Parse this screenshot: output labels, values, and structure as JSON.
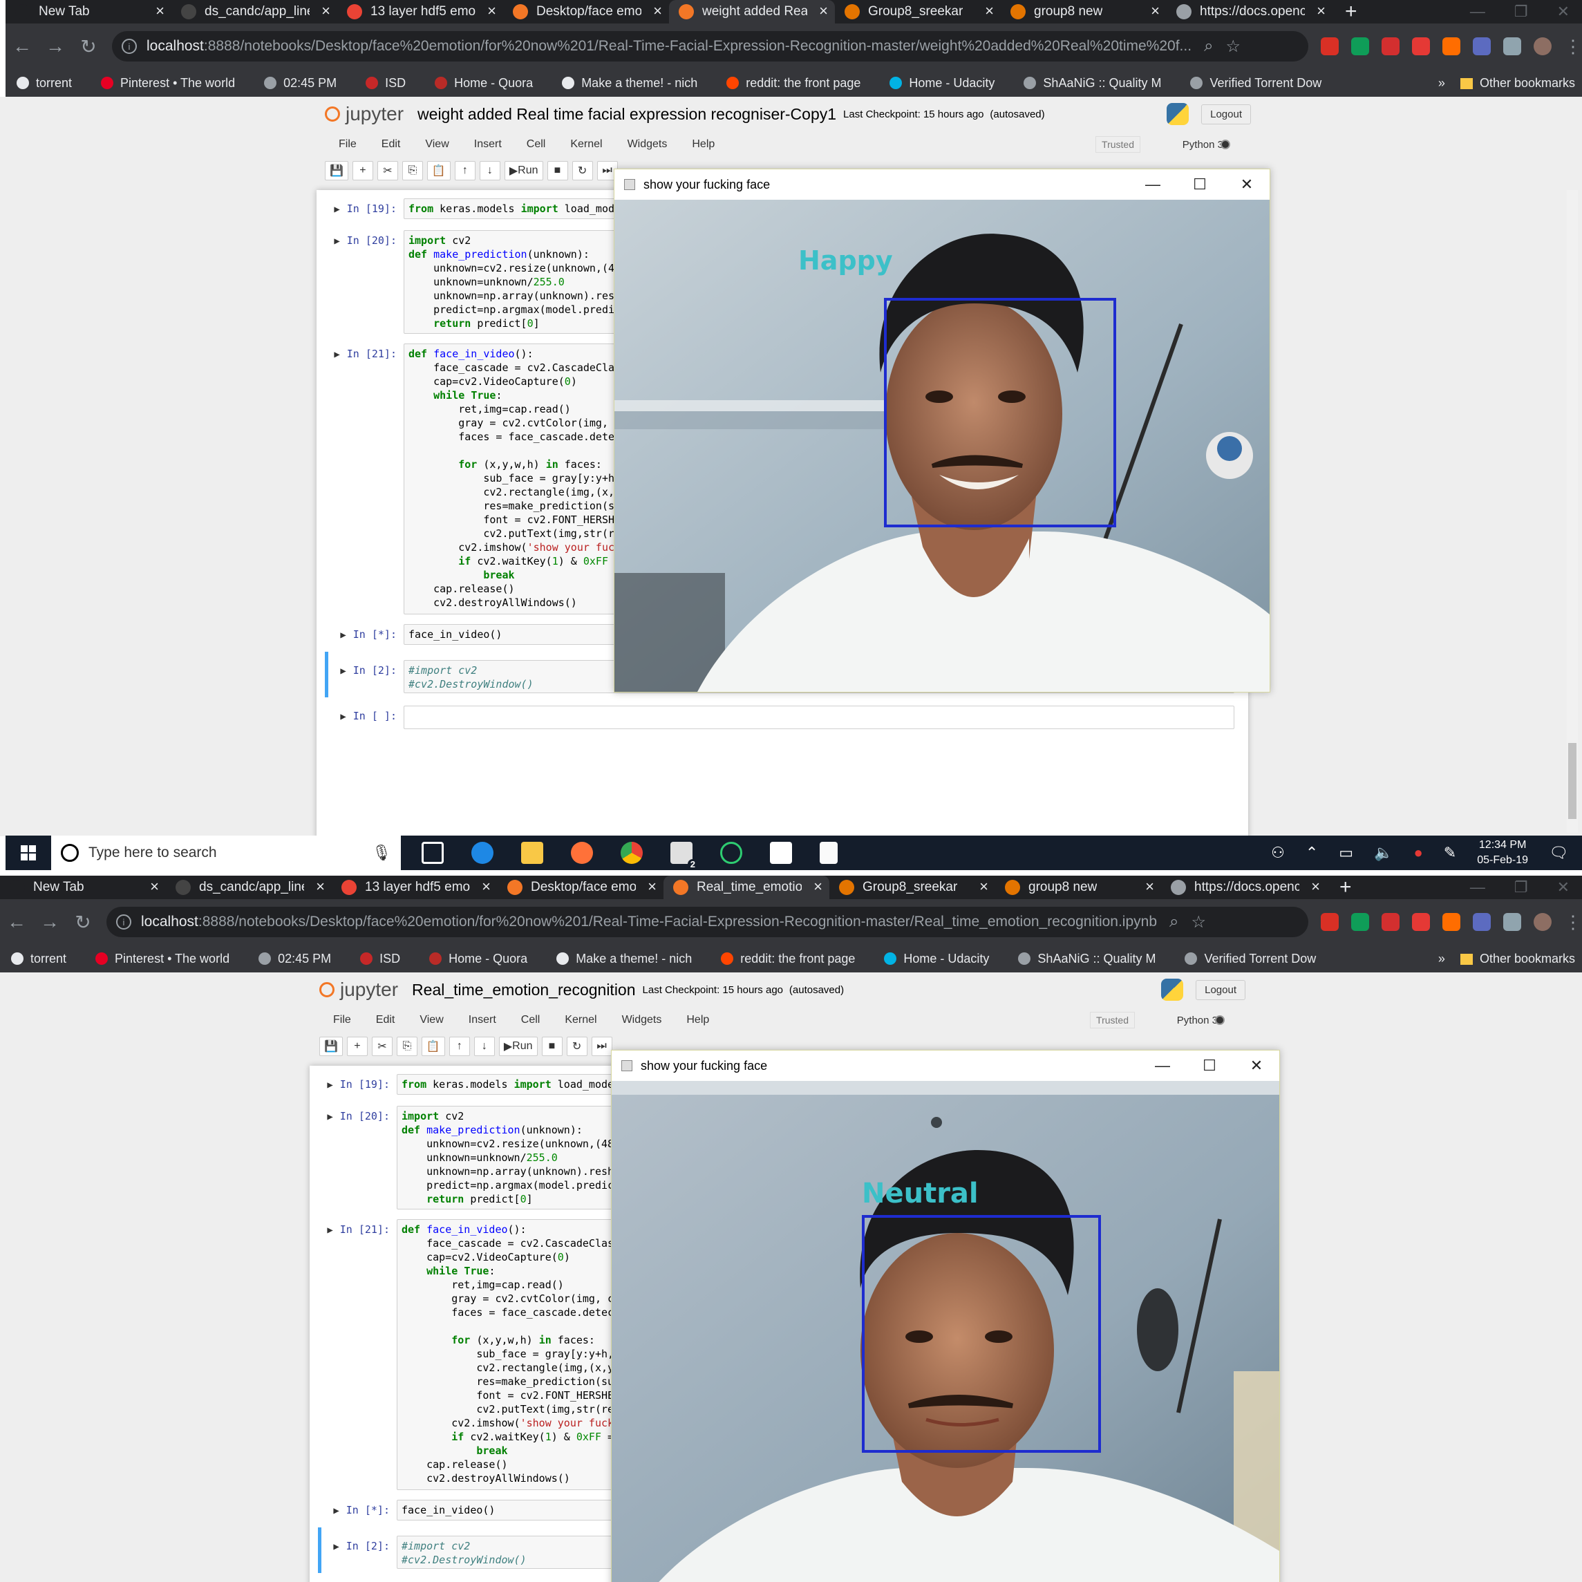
{
  "browser": {
    "tabs_top": [
      {
        "label": "New Tab",
        "icon": "blank-icon",
        "color": "#202124"
      },
      {
        "label": "ds_candc/app_line",
        "icon": "github-icon",
        "color": "#444"
      },
      {
        "label": "13 layer hdf5 emo",
        "icon": "google-icon",
        "color": "#ea4335"
      },
      {
        "label": "Desktop/face emo",
        "icon": "jupyter-icon",
        "color": "#f37726"
      },
      {
        "label": "weight added Rea",
        "icon": "hourglass-icon",
        "color": "#f37726"
      },
      {
        "label": "Group8_sreekar",
        "icon": "notebook-icon",
        "color": "#e37400"
      },
      {
        "label": "group8 new",
        "icon": "notebook-icon",
        "color": "#e37400"
      },
      {
        "label": "https://docs.openc",
        "icon": "page-icon",
        "color": "#9aa0a6"
      }
    ],
    "tabs_bottom": [
      {
        "label": "New Tab",
        "icon": "blank-icon",
        "color": "#202124"
      },
      {
        "label": "ds_candc/app_line",
        "icon": "github-icon",
        "color": "#444"
      },
      {
        "label": "13 layer hdf5 emo",
        "icon": "google-icon",
        "color": "#ea4335"
      },
      {
        "label": "Desktop/face emo",
        "icon": "jupyter-icon",
        "color": "#f37726"
      },
      {
        "label": "Real_time_emotio",
        "icon": "hourglass-icon",
        "color": "#f37726"
      },
      {
        "label": "Group8_sreekar",
        "icon": "notebook-icon",
        "color": "#e37400"
      },
      {
        "label": "group8 new",
        "icon": "notebook-icon",
        "color": "#e37400"
      },
      {
        "label": "https://docs.openc",
        "icon": "page-icon",
        "color": "#9aa0a6"
      }
    ],
    "url_top_host": "localhost",
    "url_top_path": ":8888/notebooks/Desktop/face%20emotion/for%20now%201/Real-Time-Facial-Expression-Recognition-master/weight%20added%20Real%20time%20f...",
    "url_bottom_host": "localhost",
    "url_bottom_path": ":8888/notebooks/Desktop/face%20emotion/for%20now%201/Real-Time-Facial-Expression-Recognition-master/Real_time_emotion_recognition.ipynb",
    "bookmarks": [
      {
        "label": "torrent",
        "icon": "monitor-icon",
        "color": "#e8eaed"
      },
      {
        "label": "Pinterest • The world",
        "icon": "pinterest-icon",
        "color": "#e60023"
      },
      {
        "label": "02:45 PM",
        "icon": "page-icon",
        "color": "#9aa0a6"
      },
      {
        "label": "ISD",
        "icon": "isd-icon",
        "color": "#c62828"
      },
      {
        "label": "Home - Quora",
        "icon": "quora-icon",
        "color": "#b92b27"
      },
      {
        "label": "Make a theme! - nich",
        "icon": "github-icon",
        "color": "#e8eaed"
      },
      {
        "label": "reddit: the front page",
        "icon": "reddit-icon",
        "color": "#ff4500"
      },
      {
        "label": "Home - Udacity",
        "icon": "udacity-icon",
        "color": "#02b3e4"
      },
      {
        "label": "ShAaNiG :: Quality M",
        "icon": "ub-icon",
        "color": "#9aa0a6"
      },
      {
        "label": "Verified Torrent Dow",
        "icon": "ub-icon",
        "color": "#9aa0a6"
      }
    ],
    "other_bookmarks": "Other bookmarks",
    "more": "»"
  },
  "jupyter_top": {
    "logo": "jupyter",
    "title": "weight added Real time facial expression recogniser-Copy1",
    "checkpoint": "Last Checkpoint: 15 hours ago",
    "autosaved": "(autosaved)",
    "logout": "Logout",
    "trusted": "Trusted",
    "kernel": "Python 3"
  },
  "jupyter_bottom": {
    "logo": "jupyter",
    "title": "Real_time_emotion_recognition",
    "checkpoint": "Last Checkpoint: 15 hours ago",
    "autosaved": "(autosaved)",
    "logout": "Logout",
    "trusted": "Trusted",
    "kernel": "Python 3"
  },
  "menu": [
    "File",
    "Edit",
    "View",
    "Insert",
    "Cell",
    "Kernel",
    "Widgets",
    "Help"
  ],
  "toolbar": {
    "run": "Run"
  },
  "cells": {
    "c19_prompt": "In [19]:",
    "c20_prompt": "In [20]:",
    "c21_prompt": "In [21]:",
    "cstar_prompt": "In [*]:",
    "c2_prompt": "In [2]:",
    "cempty_prompt": "In [ ]:"
  },
  "cvwindow": {
    "title": "show your fucking face",
    "label_top": "Happy",
    "label_bottom": "Neutral",
    "label_color": "#3cc0c8",
    "box_color": "#1e2ccf"
  },
  "taskbar": {
    "search_placeholder": "Type here to search",
    "time": "12:34 PM",
    "date": "05-Feb-19",
    "mail_badge": "2"
  }
}
